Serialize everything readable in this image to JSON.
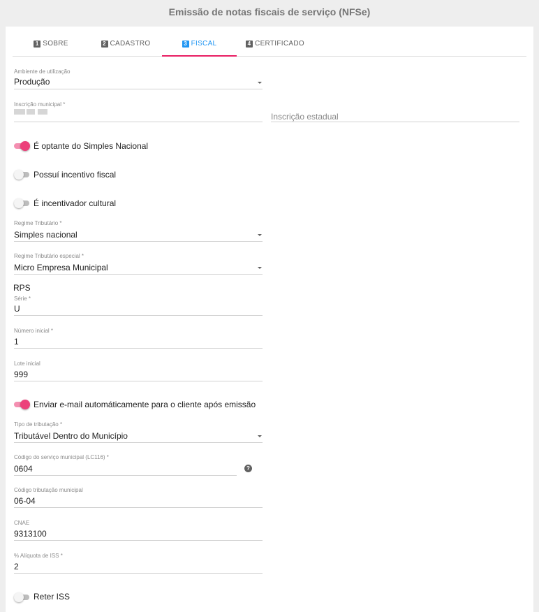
{
  "header": {
    "title": "Emissão de notas fiscais de serviço (NFSe)"
  },
  "tabs": [
    {
      "num": "1",
      "label": "SOBRE",
      "active": false
    },
    {
      "num": "2",
      "label": "CADASTRO",
      "active": false
    },
    {
      "num": "3",
      "label": "FISCAL",
      "active": true
    },
    {
      "num": "4",
      "label": "CERTIFICADO",
      "active": false
    }
  ],
  "fields": {
    "ambiente": {
      "label": "Ambiente de utilização",
      "value": "Produção"
    },
    "inscricao_municipal": {
      "label": "Inscrição municipal *",
      "value": ""
    },
    "inscricao_estadual": {
      "placeholder": "Inscrição estadual"
    },
    "regime_tributario": {
      "label": "Regime Tributário *",
      "value": "Simples nacional"
    },
    "regime_especial": {
      "label": "Regime Tributário especial *",
      "value": "Micro Empresa Municipal"
    },
    "serie": {
      "label": "Série *",
      "value": "U"
    },
    "numero_inicial": {
      "label": "Número inicial *",
      "value": "1"
    },
    "lote_inicial": {
      "label": "Lote inicial",
      "value": "999"
    },
    "tipo_tributacao": {
      "label": "Tipo de tributação *",
      "value": "Tributável Dentro do Município"
    },
    "codigo_servico": {
      "label": "Código do serviço municipal (LC116) *",
      "value": "0604"
    },
    "codigo_tributacao": {
      "label": "Código tributação municipal",
      "value": "06-04"
    },
    "cnae": {
      "label": "CNAE",
      "value": "9313100"
    },
    "aliquota": {
      "label": "% Alíquota de ISS *",
      "value": "2"
    }
  },
  "toggles": {
    "simples_nacional": {
      "label": "É optante do Simples Nacional",
      "on": true
    },
    "incentivo_fiscal": {
      "label": "Possuí incentivo fiscal",
      "on": false
    },
    "incentivador_cultural": {
      "label": "É incentivador cultural",
      "on": false
    },
    "enviar_email": {
      "label": "Enviar e-mail automáticamente para o cliente após emissão",
      "on": true
    },
    "reter_iss": {
      "label": "Reter ISS",
      "on": false
    }
  },
  "sections": {
    "rps": "RPS"
  },
  "help": {
    "icon": "help-circle-icon",
    "glyph": "?"
  },
  "colors": {
    "accent_blue": "#2196f3",
    "accent_pink": "#e91e63",
    "toggle_on": "#ec407a"
  }
}
